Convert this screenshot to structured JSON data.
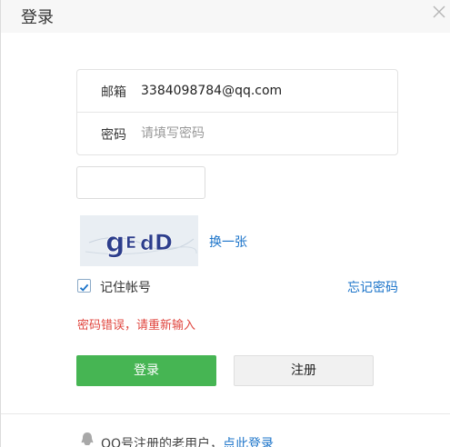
{
  "dialog": {
    "title": "登录",
    "close_icon": "close-icon"
  },
  "form": {
    "email_label": "邮箱",
    "email_value": "3384098784@qq.com",
    "password_label": "密码",
    "password_placeholder": "请填写密码"
  },
  "captcha": {
    "image_text": "gEdD",
    "refresh_label": "换一张"
  },
  "remember": {
    "label": "记住帐号",
    "checked": true
  },
  "forgot_label": "忘记密码",
  "error_message": "密码错误，请重新输入",
  "buttons": {
    "login": "登录",
    "register": "注册"
  },
  "footer": {
    "text": "QQ号注册的老用户，",
    "link": "点此登录",
    "icon": "qq-user-icon"
  },
  "colors": {
    "primary_green": "#46b553",
    "link_blue": "#1a73c9",
    "error_red": "#e0463f"
  }
}
